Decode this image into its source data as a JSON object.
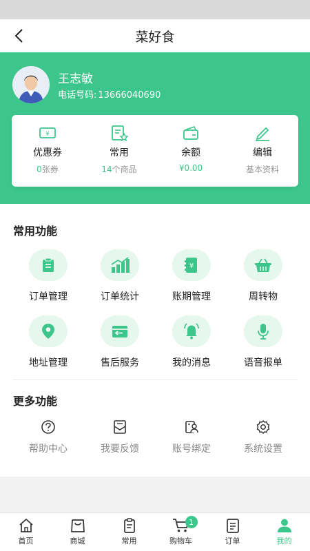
{
  "app": {
    "title": "菜好食"
  },
  "user": {
    "name": "王志敏",
    "phone_label": "电话号码:",
    "phone": "13666040690"
  },
  "stats": [
    {
      "label": "优惠券",
      "value": "0",
      "unit": "张券"
    },
    {
      "label": "常用",
      "value": "14",
      "unit": "个商品"
    },
    {
      "label": "余额",
      "value": "¥0.00",
      "unit": ""
    },
    {
      "label": "编辑",
      "value": "",
      "unit": "基本资料"
    }
  ],
  "common": {
    "title": "常用功能",
    "items": [
      {
        "label": "订单管理",
        "icon": "clipboard-icon"
      },
      {
        "label": "订单统计",
        "icon": "chart-icon"
      },
      {
        "label": "账期管理",
        "icon": "ledger-icon"
      },
      {
        "label": "周转物",
        "icon": "basket-icon"
      },
      {
        "label": "地址管理",
        "icon": "location-pin-icon"
      },
      {
        "label": "售后服务",
        "icon": "return-box-icon"
      },
      {
        "label": "我的消息",
        "icon": "bell-icon"
      },
      {
        "label": "语音报单",
        "icon": "microphone-icon"
      }
    ]
  },
  "more": {
    "title": "更多功能",
    "items": [
      {
        "label": "帮助中心",
        "icon": "help-icon"
      },
      {
        "label": "我要反馈",
        "icon": "feedback-icon"
      },
      {
        "label": "账号绑定",
        "icon": "account-bind-icon"
      },
      {
        "label": "系统设置",
        "icon": "settings-icon"
      }
    ]
  },
  "tabs": [
    {
      "label": "首页",
      "icon": "home-icon"
    },
    {
      "label": "商城",
      "icon": "shopping-bag-icon"
    },
    {
      "label": "常用",
      "icon": "clipboard-icon"
    },
    {
      "label": "购物车",
      "icon": "cart-icon",
      "badge": "1"
    },
    {
      "label": "订单",
      "icon": "order-list-icon"
    },
    {
      "label": "我的",
      "icon": "user-icon",
      "active": true
    }
  ],
  "colors": {
    "accent": "#3dc68c",
    "icon_bg": "#e6f7ee"
  }
}
